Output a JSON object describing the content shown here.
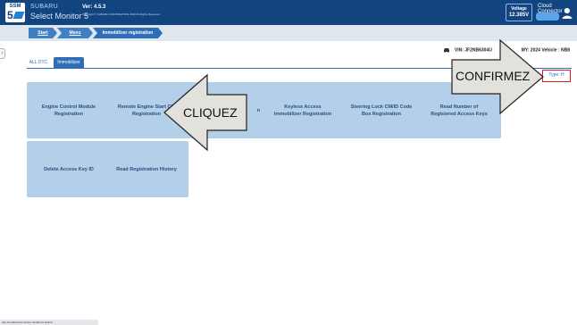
{
  "header": {
    "brand_line1": "SUBARU",
    "brand_line2": "Select Monitor 5",
    "version": "Ver: 4.5.3",
    "copyright": "Copyright © SUBARU CORPORATION 2020 All Rights Reserved.",
    "voltage_label": "Voltage",
    "voltage_value": "12.385V",
    "cloud_label": "Cloud Connector ID",
    "logo_text": "SSM",
    "logo_number": "5"
  },
  "breadcrumb": {
    "items": [
      {
        "label": "Start"
      },
      {
        "label": "Menu"
      },
      {
        "label": "Immobilizer registration"
      }
    ]
  },
  "vehicle": {
    "vin_label": "VIN: JF2NB6304U",
    "my_label": "MY: 2024",
    "vehicle_label": "Vehicle : NB8"
  },
  "tabs": [
    {
      "label": "ALL DTC",
      "active": false
    },
    {
      "label": "Immobilizer",
      "active": true
    }
  ],
  "type_box": {
    "label": "Type: H"
  },
  "tiles": [
    {
      "label": "Engine Control Module\nRegistration"
    },
    {
      "label": "Remote Engine Start CM\nRegistration"
    },
    {
      "label": "n"
    },
    {
      "label": "Keyless Access\nImmobilizer Registration"
    },
    {
      "label": "Steering Lock CM/ID Code\nBox Registration"
    },
    {
      "label": "Read Number of\nRegistered Access Keys"
    },
    {
      "label": "Delete Access Key ID"
    },
    {
      "label": "Read Registration History"
    }
  ],
  "callouts": {
    "cliquez": "CLIQUEZ",
    "confirmez": "CONFIRMEZ"
  },
  "status_bar": "http://localhost/smr/index.html#/immobilizer"
}
